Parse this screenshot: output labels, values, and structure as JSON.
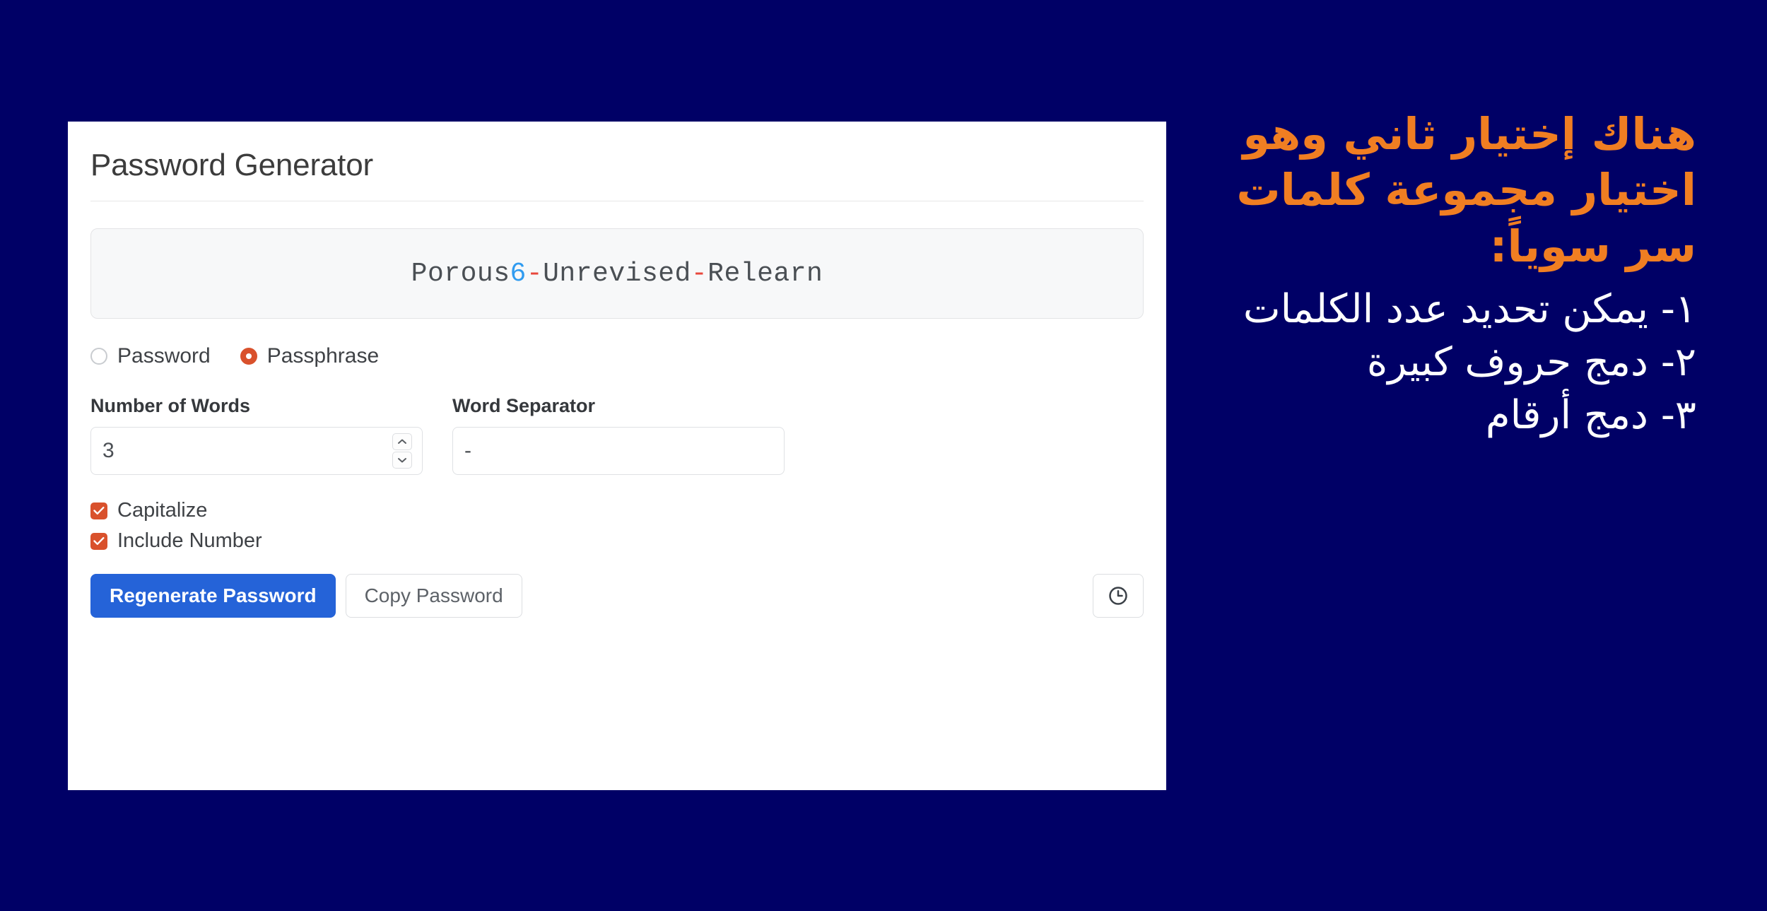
{
  "page": {
    "background_color": "#000066"
  },
  "card": {
    "title": "Password Generator",
    "password_display": {
      "prefix": "Porous",
      "number": "6",
      "separator_1": "-",
      "word_2": "Unrevised",
      "separator_2": "-",
      "word_3": "Relearn",
      "full_value": "Porous6-Unrevised-Relearn",
      "number_color": "#2f9bf0",
      "separator_color": "#e8483c"
    },
    "mode_options": [
      {
        "label": "Password",
        "selected": false
      },
      {
        "label": "Passphrase",
        "selected": true
      }
    ],
    "fields": [
      {
        "label": "Number of Words",
        "value": "3",
        "placeholder": "",
        "has_spinner": true
      },
      {
        "label": "Word Separator",
        "value": "-",
        "placeholder": "",
        "has_spinner": false
      }
    ],
    "checkboxes": [
      {
        "label": "Capitalize",
        "checked": true
      },
      {
        "label": "Include Number",
        "checked": true
      }
    ],
    "buttons": {
      "regenerate_label": "Regenerate Password",
      "copy_label": "Copy Password",
      "history_icon": "clock-icon"
    },
    "accent_colors": {
      "primary_button": "#2563d8",
      "control_accent": "#d9512c"
    }
  },
  "annotation": {
    "heading": "هناك إختيار ثاني وهو اختيار مجموعة كلمات سر سوياً:",
    "heading_color": "#F07E22",
    "items": [
      "١- يمكن تحديد عدد الكلمات",
      "٢- دمج حروف كبيرة",
      "٣- دمج أرقام"
    ],
    "items_color": "#ffffff"
  }
}
